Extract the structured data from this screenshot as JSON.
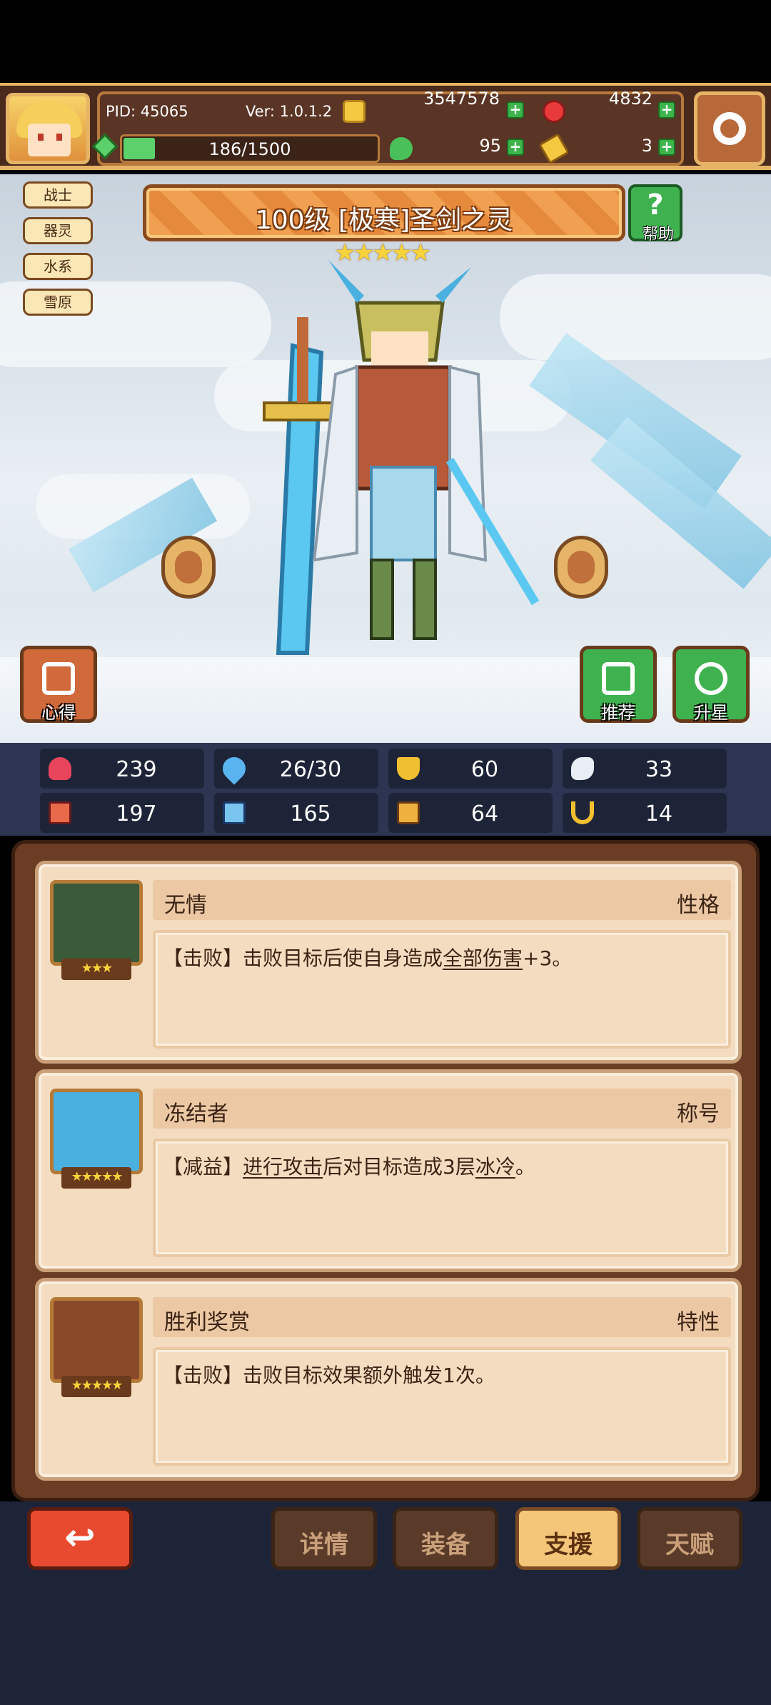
{
  "hud": {
    "pid": "PID: 45065",
    "version": "Ver: 1.0.1.2",
    "gold": "3547578",
    "red_gems": "4832",
    "energy": "186/1500",
    "energy_fraction": 0.124,
    "clover": "95",
    "tickets": "3"
  },
  "hero": {
    "tags": [
      "战士",
      "器灵",
      "水系",
      "雪原"
    ],
    "title": "100级  [极寒]圣剑之灵",
    "stars": "★★★★★",
    "star_count": 5,
    "help_label": "帮助",
    "insight_label": "心得",
    "recommend_label": "推荐",
    "star_up_label": "升星"
  },
  "stats": [
    {
      "icon": "heart-icon",
      "value": "239",
      "color": "#e8455c"
    },
    {
      "icon": "water-drop-icon",
      "value": "26/30",
      "color": "#5ab4f0"
    },
    {
      "icon": "shield-icon",
      "value": "60",
      "color": "#f0c030"
    },
    {
      "icon": "wing-icon",
      "value": "33",
      "color": "#e8eef4"
    },
    {
      "icon": "fist-icon",
      "value": "197",
      "color": "#e86a4a"
    },
    {
      "icon": "book-icon",
      "value": "165",
      "color": "#7ac4f0"
    },
    {
      "icon": "scroll-icon",
      "value": "64",
      "color": "#f0b040"
    },
    {
      "icon": "horseshoe-icon",
      "value": "14",
      "color": "#f0c030"
    }
  ],
  "traits": [
    {
      "name": "无情",
      "type": "性格",
      "stars": "★★★",
      "desc_prefix": "【击败】击败目标后使自身造成",
      "desc_link": "全部伤害",
      "desc_suffix": "+3。",
      "portrait_color": "#3a5a3a"
    },
    {
      "name": "冻结者",
      "type": "称号",
      "stars": "★★★★★",
      "desc_prefix": "【减益】",
      "desc_link": "进行攻击",
      "desc_mid": "后对目标造成3层",
      "desc_link2": "冰冷",
      "desc_suffix": "。",
      "portrait_color": "#4ab0e0"
    },
    {
      "name": "胜利奖赏",
      "type": "特性",
      "stars": "★★★★★",
      "desc_prefix": "【击败】击败目标效果额外触发1次。",
      "portrait_color": "#8a4a2a"
    }
  ],
  "nav": {
    "back": "↩",
    "details": "详情",
    "equipment": "装备",
    "support": "支援",
    "talent": "天赋"
  }
}
